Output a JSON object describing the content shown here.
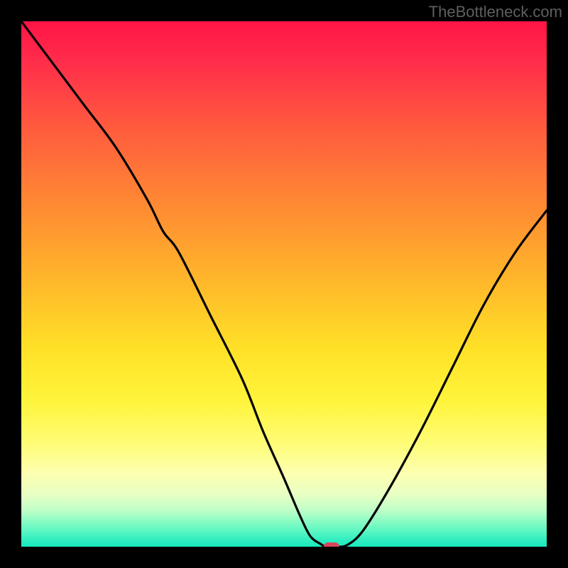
{
  "watermark": "TheBottleneck.com",
  "colors": {
    "frame": "#000000",
    "curve": "#000000",
    "marker": "#d9465c"
  },
  "chart_data": {
    "type": "line",
    "title": "",
    "xlabel": "",
    "ylabel": "",
    "xlim": [
      0,
      100
    ],
    "ylim": [
      0,
      100
    ],
    "grid": false,
    "legend": false,
    "series": [
      {
        "name": "bottleneck-curve",
        "x": [
          0,
          6,
          12,
          18,
          24,
          27,
          30,
          36,
          42,
          46,
          50,
          53,
          55,
          57,
          58,
          60,
          62,
          65,
          70,
          76,
          82,
          88,
          94,
          100
        ],
        "values": [
          100,
          92,
          84,
          76,
          66,
          60,
          56,
          44,
          32,
          22,
          13,
          6,
          2,
          0.5,
          0,
          0,
          0.3,
          3,
          11,
          22,
          34,
          46,
          56,
          64
        ]
      }
    ],
    "marker": {
      "x": 59,
      "y": 0
    },
    "gradient_stops": [
      {
        "pos": 0,
        "color": "#ff1447"
      },
      {
        "pos": 0.35,
        "color": "#ff8a33"
      },
      {
        "pos": 0.62,
        "color": "#ffe027"
      },
      {
        "pos": 0.86,
        "color": "#fdffb0"
      },
      {
        "pos": 1.0,
        "color": "#18e9be"
      }
    ]
  }
}
